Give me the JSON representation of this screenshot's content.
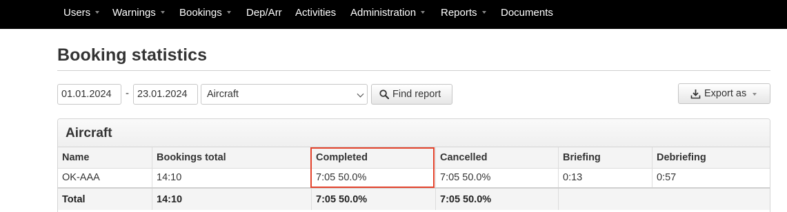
{
  "nav": {
    "items": [
      {
        "label": "Users",
        "dropdown": true
      },
      {
        "label": "Warnings",
        "dropdown": true
      },
      {
        "label": "Bookings",
        "dropdown": true
      },
      {
        "label": "Dep/Arr",
        "dropdown": false
      },
      {
        "label": "Activities",
        "dropdown": false
      },
      {
        "label": "Administration",
        "dropdown": true
      },
      {
        "label": "Reports",
        "dropdown": true
      },
      {
        "label": "Documents",
        "dropdown": false
      }
    ]
  },
  "page": {
    "title": "Booking statistics"
  },
  "filters": {
    "date_from": "01.01.2024",
    "date_separator": "-",
    "date_to": "23.01.2024",
    "group_by": "Aircraft",
    "find_label": "Find report",
    "export_label": "Export as"
  },
  "panel": {
    "title": "Aircraft",
    "columns": [
      "Name",
      "Bookings total",
      "Completed",
      "Cancelled",
      "Briefing",
      "Debriefing"
    ],
    "rows": [
      [
        "OK-AAA",
        "14:10",
        "7:05 50.0%",
        "7:05 50.0%",
        "0:13",
        "0:57"
      ]
    ],
    "total": [
      "Total",
      "14:10",
      "7:05 50.0%",
      "7:05 50.0%",
      "",
      ""
    ]
  },
  "colors": {
    "nav_bg": "#000000",
    "highlight": "#e3422b"
  },
  "icons": {
    "find": "search-icon",
    "export": "download-icon",
    "select": "chevron-down-icon"
  }
}
